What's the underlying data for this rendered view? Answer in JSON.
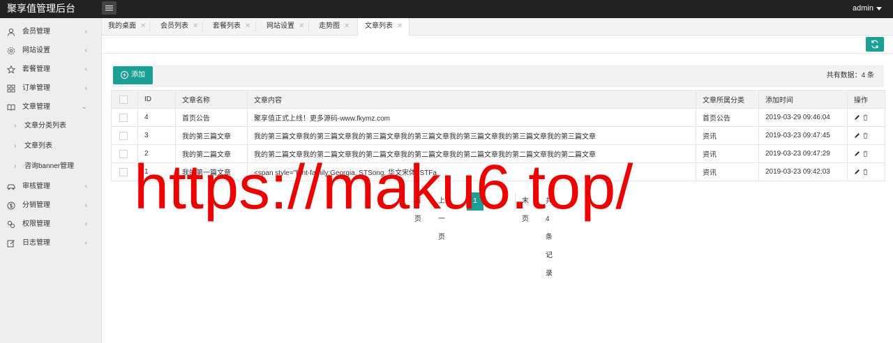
{
  "app": {
    "title": "聚享值管理后台",
    "user": "admin"
  },
  "sidebar": {
    "items": [
      {
        "label": "会员管理",
        "icon": "user-icon",
        "arrow": "‹"
      },
      {
        "label": "网站设置",
        "icon": "gear-icon",
        "arrow": "‹"
      },
      {
        "label": "套餐管理",
        "icon": "star-icon",
        "arrow": "‹"
      },
      {
        "label": "订单管理",
        "icon": "grid-icon",
        "arrow": "‹"
      },
      {
        "label": "文章管理",
        "icon": "book-icon",
        "arrow": "⌄"
      },
      {
        "label": "审核管理",
        "icon": "car-icon",
        "arrow": "‹"
      },
      {
        "label": "分销管理",
        "icon": "dollar-icon",
        "arrow": "‹"
      },
      {
        "label": "权限管理",
        "icon": "link-icon",
        "arrow": "‹"
      },
      {
        "label": "日志管理",
        "icon": "edit-icon",
        "arrow": "‹"
      }
    ],
    "subitems": [
      {
        "label": "文章分类列表",
        "bullet": "›"
      },
      {
        "label": "文章列表",
        "bullet": "›"
      },
      {
        "label": "咨询banner管理",
        "bullet": "›"
      }
    ]
  },
  "tabs": [
    {
      "label": "我的桌面",
      "close": "✕"
    },
    {
      "label": "会员列表",
      "close": "✕"
    },
    {
      "label": "套餐列表",
      "close": "✕"
    },
    {
      "label": "网站设置",
      "close": "✕"
    },
    {
      "label": "走势图",
      "close": "✕"
    },
    {
      "label": "文章列表",
      "close": "✕",
      "active": true
    }
  ],
  "toolbar": {
    "add_label": "添加",
    "total": "共有数据：4 条"
  },
  "table": {
    "headers": [
      "ID",
      "文章名称",
      "文章内容",
      "文章所属分类",
      "添加时间",
      "操作"
    ],
    "rows": [
      {
        "id": "4",
        "name": "首页公告",
        "content": "聚享值正式上线！更多源码-www.fkymz.com",
        "category": "首页公告",
        "time": "2019-03-29 09:46:04"
      },
      {
        "id": "3",
        "name": "我的第三篇文章",
        "content": "我的第三篇文章我的第三篇文章我的第三篇文章我的第三篇文章我的第三篇文章我的第三篇文章我的第三篇文章",
        "category": "资讯",
        "time": "2019-03-23 09:47:45"
      },
      {
        "id": "2",
        "name": "我的第二篇文章",
        "content": "我的第二篇文章我的第二篇文章我的第二篇文章我的第二篇文章我的第二篇文章我的第二篇文章我的第二篇文章",
        "category": "资讯",
        "time": "2019-03-23 09:47:29"
      },
      {
        "id": "1",
        "name": "我的第一篇文章",
        "content": "<span style=\"font-family:Georgia, STSong, 华文宋体, STFa",
        "category": "资讯",
        "time": "2019-03-23 09:42:03"
      }
    ]
  },
  "pager": {
    "first": "首页",
    "prev": "上一页",
    "current": "1",
    "last": "末页",
    "summary": "共 4 条记录"
  },
  "watermark": "https://maku6.top/",
  "colors": {
    "accent": "#1aa094",
    "topbar": "#222222",
    "watermark": "#f20000"
  }
}
